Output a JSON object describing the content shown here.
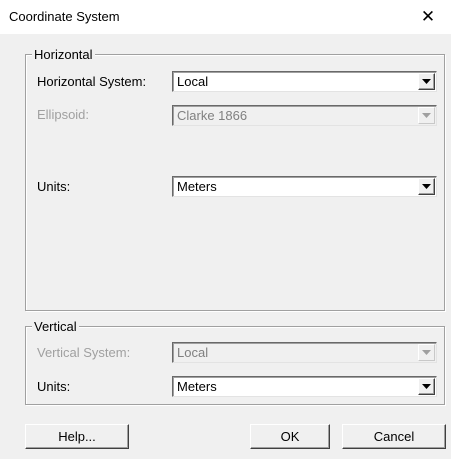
{
  "window": {
    "title": "Coordinate System",
    "close_glyph": "✕"
  },
  "horizontal": {
    "legend": "Horizontal",
    "system_label": "Horizontal System:",
    "system_value": "Local",
    "ellipsoid_label": "Ellipsoid:",
    "ellipsoid_value": "Clarke 1866",
    "units_label": "Units:",
    "units_value": "Meters"
  },
  "vertical": {
    "legend": "Vertical",
    "system_label": "Vertical System:",
    "system_value": "Local",
    "units_label": "Units:",
    "units_value": "Meters"
  },
  "buttons": {
    "help": "Help...",
    "ok": "OK",
    "cancel": "Cancel"
  },
  "icons": {
    "dropdown": "chevron-down-icon",
    "close": "close-icon"
  },
  "colors": {
    "dialog_bg": "#f0f0f0",
    "disabled_text": "#a0a0a0"
  }
}
